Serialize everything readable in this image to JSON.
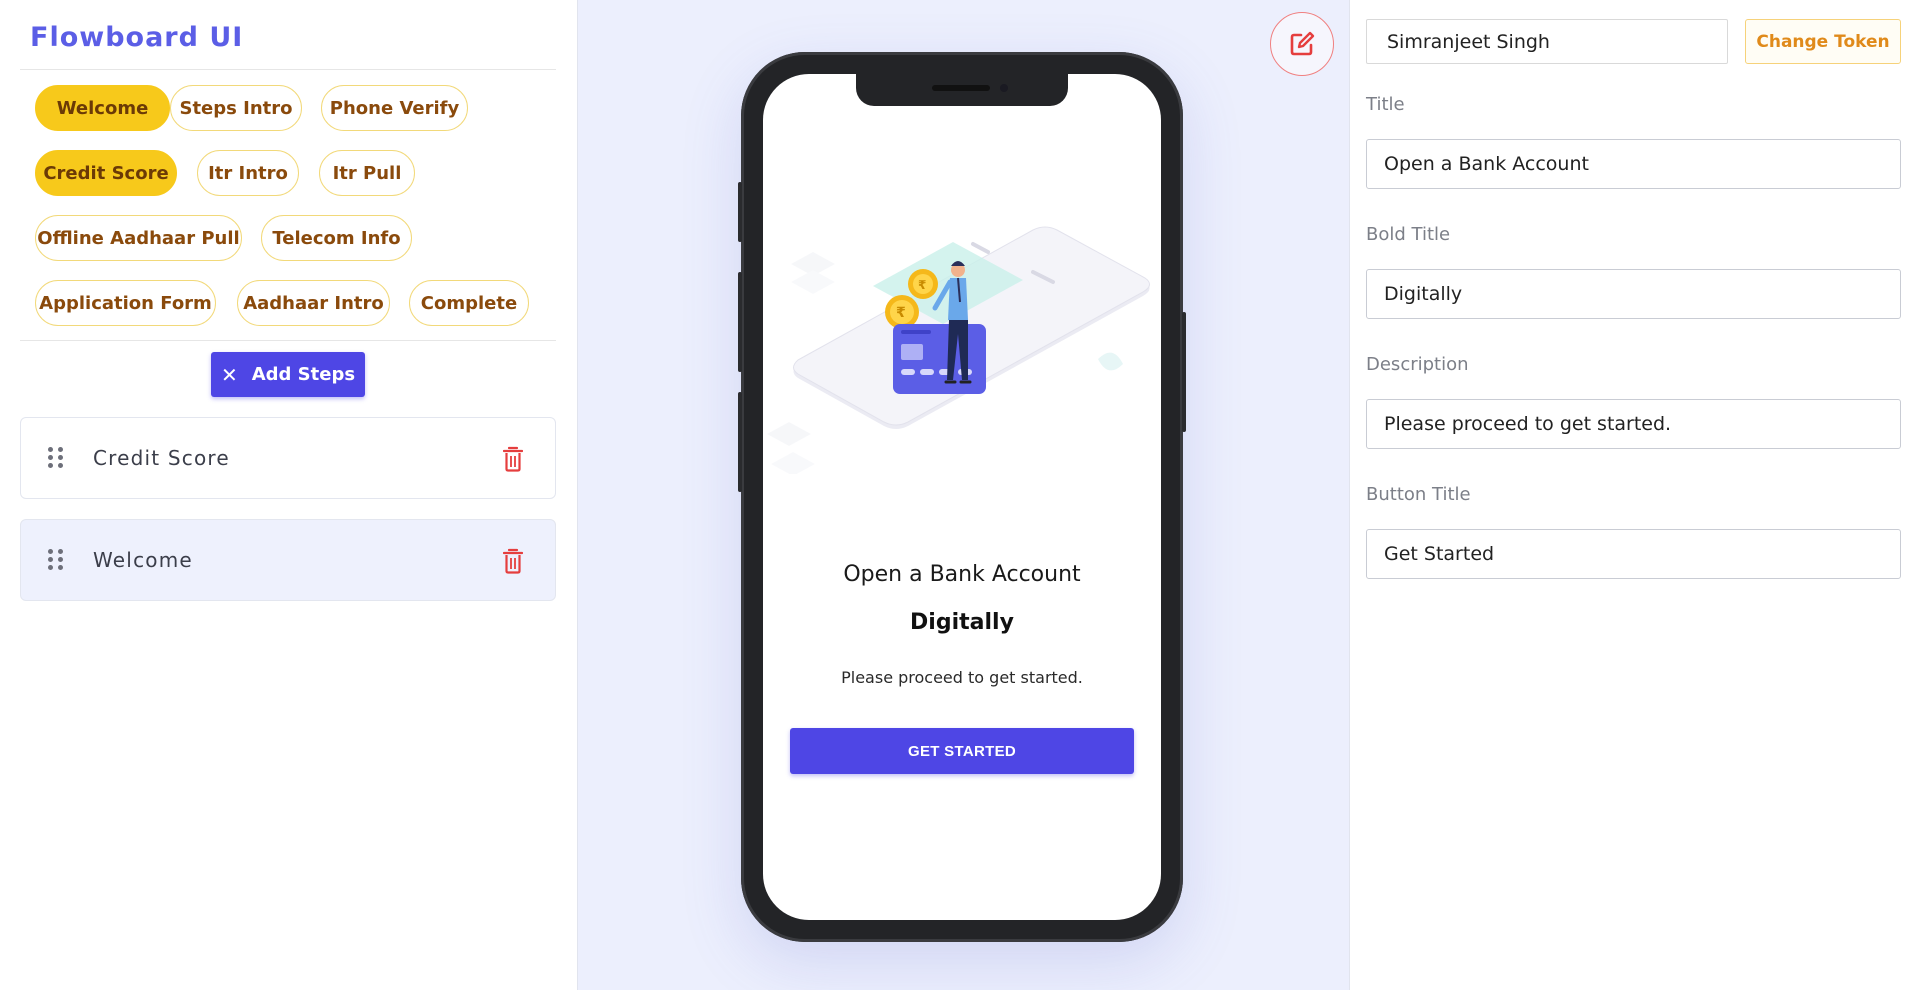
{
  "app": {
    "title": "Flowboard UI"
  },
  "chips": [
    {
      "label": "Welcome",
      "active": true
    },
    {
      "label": "Steps Intro",
      "active": false
    },
    {
      "label": "Phone Verify",
      "active": false
    },
    {
      "label": "Credit Score",
      "active": true
    },
    {
      "label": "Itr Intro",
      "active": false
    },
    {
      "label": "Itr Pull",
      "active": false
    },
    {
      "label": "Offline Aadhaar Pull",
      "active": false
    },
    {
      "label": "Telecom Info",
      "active": false
    },
    {
      "label": "Application Form",
      "active": false
    },
    {
      "label": "Aadhaar Intro",
      "active": false
    },
    {
      "label": "Complete",
      "active": false
    }
  ],
  "add_steps": {
    "label": "Add Steps",
    "icon": "close-icon"
  },
  "steps": [
    {
      "label": "Credit Score",
      "selected": false
    },
    {
      "label": "Welcome",
      "selected": true
    }
  ],
  "preview": {
    "title": "Open a Bank Account",
    "bold_title": "Digitally",
    "description": "Please proceed to get started.",
    "button": "GET STARTED"
  },
  "token": {
    "user": "Simranjeet Singh",
    "change_label": "Change Token"
  },
  "form": {
    "title_label": "Title",
    "title_value": "Open a Bank Account",
    "bold_title_label": "Bold Title",
    "bold_title_value": "Digitally",
    "description_label": "Description",
    "description_value": "Please proceed to get started.",
    "button_title_label": "Button Title",
    "button_title_value": "Get Started"
  },
  "colors": {
    "brand": "#5b5ee6",
    "primary": "#4e46e5",
    "chip_active": "#f7c91b",
    "chip_text": "#8a4a0c",
    "danger": "#e53e3e",
    "accent_orange": "#e08a1a"
  }
}
